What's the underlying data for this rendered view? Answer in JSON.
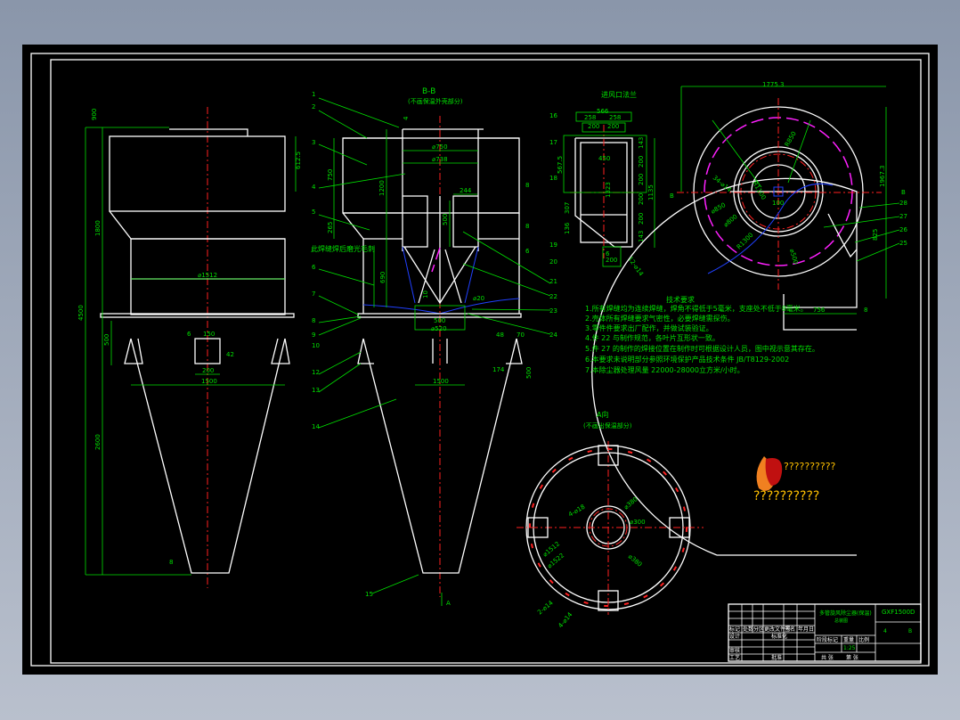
{
  "drawing": {
    "colors": {
      "background": "#000000",
      "outline": "#ffffff",
      "dimension": "#00e000",
      "centerline": "#ff2020",
      "insulation": "#ff20ff",
      "curve": "#2040ff"
    },
    "left_view": {
      "dims": [
        "900",
        "1800",
        "4500",
        "2600",
        "500",
        "612.5",
        "⌀1512",
        "150",
        "200",
        "1500",
        "6",
        "8",
        "42"
      ]
    },
    "section_bb": {
      "title": "B-B",
      "subtitle": "(不画保温外壳部分)",
      "dims": [
        "⌀750",
        "⌀738",
        "1200",
        "750",
        "265",
        "244",
        "500",
        "690",
        "500",
        "⌀520",
        "1500",
        "48",
        "70",
        "174",
        "500",
        "⌀20",
        "4",
        "10"
      ],
      "callouts": [
        "1",
        "2",
        "3",
        "4",
        "5",
        "6",
        "7",
        "8",
        "9",
        "10",
        "12",
        "13",
        "14",
        "15",
        "16",
        "17",
        "18",
        "19",
        "20",
        "21",
        "22",
        "23",
        "24",
        "8",
        "8",
        "6"
      ],
      "weld_note": "此焊缝焊后磨光毛刺",
      "view_arrow": "A"
    },
    "flange_view": {
      "title": "进风口法兰",
      "dims": [
        "566",
        "258",
        "258",
        "200",
        "200",
        "450",
        "567.5",
        "1323",
        "1135",
        "143",
        "200",
        "200",
        "200",
        "200",
        "143",
        "307",
        "136",
        "200",
        "6",
        "12-⌀14"
      ]
    },
    "volute_view": {
      "dims": [
        "1775.3",
        "1967.3",
        "756",
        "825",
        "R850",
        "R1100",
        "⌀850",
        "⌀800",
        "R1300",
        "⌀500",
        "100",
        "34-⌀14",
        "B",
        "B",
        "8"
      ],
      "callouts": [
        "28",
        "27",
        "26",
        "25"
      ]
    },
    "tech_requirements": {
      "title": "技术要求",
      "items": [
        "1.所有焊缝均为连续焊缝，焊角不得低于5毫米，支座处不低于8毫米。",
        "2.壳体所有焊缝要求气密性，必要焊缝需探伤。",
        "3.零件件要求出厂配作，并做试装验证。",
        "4.件 22 与制作规范，各叶片互形状一致。",
        "5.件 27 的制作的焊接位置在制作时可根据设计人员，图中视示意其存在。",
        "6.本要求未说明部分参照环境保护产品技术条件 JB/T8129-2002",
        "7.本除尘器处理风量 22000-28000立方米/小时。"
      ]
    },
    "view_a": {
      "title": "A向",
      "subtitle": "(不画出保温部分)",
      "dims": [
        "⌀1512",
        "⌀1522",
        "⌀300",
        "⌀380",
        "4-⌀18",
        "2-⌀14",
        "4-⌀14"
      ]
    },
    "logo": {
      "text": "??????????",
      "subtext": "??????????"
    },
    "title_block": {
      "drawing_no": "GXF1500D",
      "name": "多管旋风除尘器(保温)",
      "name_sub": "总装图",
      "sheet": "4",
      "sheet_of": "B",
      "scale": "1:25",
      "headers": [
        "标记",
        "处数",
        "分区",
        "更改文件号",
        "签名",
        "年月日"
      ],
      "labels": [
        "设计",
        "标准化",
        "审核",
        "工艺",
        "批准",
        "阶段标记",
        "重量",
        "比例",
        "共 张",
        "第 张"
      ]
    }
  }
}
